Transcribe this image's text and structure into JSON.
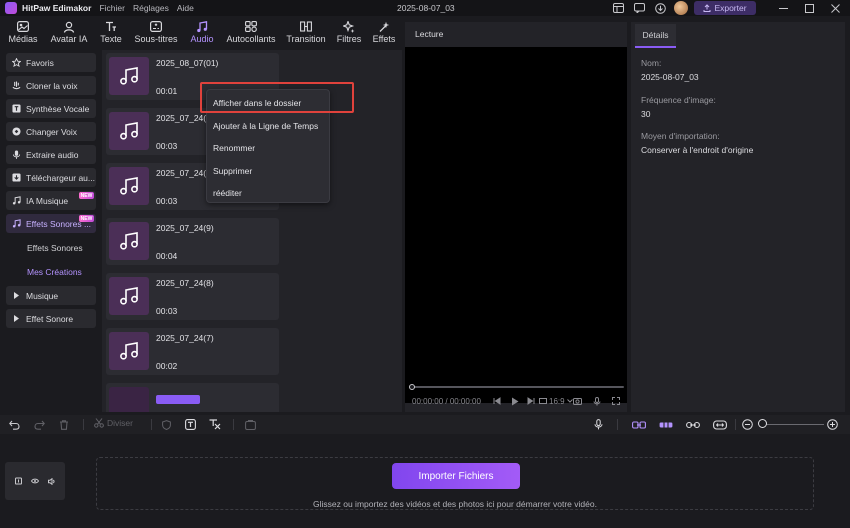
{
  "titlebar": {
    "app_name": "HitPaw Edimakor",
    "menu": [
      "Fichier",
      "Réglages",
      "Aide"
    ],
    "window_title": "2025-08-07_03",
    "export_label": "Exporter"
  },
  "top_tabs": [
    {
      "label": "Médias",
      "icon": "media-icon"
    },
    {
      "label": "Avatar IA",
      "icon": "avatar-icon"
    },
    {
      "label": "Texte",
      "icon": "text-icon"
    },
    {
      "label": "Sous-titres",
      "icon": "subtitles-icon"
    },
    {
      "label": "Audio",
      "icon": "music-note-icon",
      "active": true
    },
    {
      "label": "Autocollants",
      "icon": "stickers-icon"
    },
    {
      "label": "Transition",
      "icon": "transition-icon"
    },
    {
      "label": "Filtres",
      "icon": "filters-icon"
    },
    {
      "label": "Effets",
      "icon": "effects-icon"
    }
  ],
  "sidebar": {
    "items": [
      {
        "label": "Favoris",
        "icon": "star-icon"
      },
      {
        "label": "Cloner la voix",
        "icon": "voice-clone-icon"
      },
      {
        "label": "Synthèse Vocale",
        "icon": "tts-icon"
      },
      {
        "label": "Changer Voix",
        "icon": "voice-change-icon"
      },
      {
        "label": "Extraire audio",
        "icon": "microphone-icon"
      },
      {
        "label": "Téléchargeur au...",
        "icon": "download-icon"
      },
      {
        "label": "IA Musique",
        "icon": "ai-music-icon",
        "badge": "NEW"
      },
      {
        "label": "Effets Sonores ...",
        "icon": "sound-effects-icon",
        "badge": "NEW",
        "active": true
      }
    ],
    "sub_items": [
      {
        "label": "Effets Sonores"
      },
      {
        "label": "Mes Créations",
        "active": true
      }
    ],
    "collapsed": [
      {
        "label": "Musique",
        "icon": "caret-right-icon"
      },
      {
        "label": "Effet Sonore",
        "icon": "caret-right-icon"
      }
    ]
  },
  "media_list": [
    {
      "name": "2025_08_07(01)",
      "duration": "00:01"
    },
    {
      "name": "2025_07_24(11)",
      "duration": "00:03"
    },
    {
      "name": "2025_07_24(10)",
      "duration": "00:03"
    },
    {
      "name": "2025_07_24(9)",
      "duration": "00:04"
    },
    {
      "name": "2025_07_24(8)",
      "duration": "00:03"
    },
    {
      "name": "2025_07_24(7)",
      "duration": "00:02"
    }
  ],
  "context_menu": {
    "items": [
      "Afficher dans le dossier",
      "Ajouter à la Ligne de Temps",
      "Renommer",
      "Supprimer",
      "rééditer"
    ],
    "highlighted": 0
  },
  "preview": {
    "title": "Lecture",
    "time_current": "00:00:00",
    "time_total": "00:00:00",
    "aspect": "16:9"
  },
  "details": {
    "tab": "Détails",
    "fields": [
      {
        "label": "Nom:",
        "value": "2025-08-07_03"
      },
      {
        "label": "Fréquence d'image:",
        "value": "30"
      },
      {
        "label": "Moyen d'importation:",
        "value": "Conserver à l'endroit d'origine"
      }
    ]
  },
  "timeline": {
    "divise_label": "Diviser",
    "import_button": "Importer Fichiers",
    "hint": "Glissez ou importez des vidéos et des photos ici pour démarrer votre vidéo.",
    "zoom_minus": "−",
    "zoom_plus": "+"
  },
  "colors": {
    "accent": "#8a5cf5",
    "highlight_border": "#e0423c",
    "panel": "#232328",
    "background": "#1b1b1f"
  }
}
